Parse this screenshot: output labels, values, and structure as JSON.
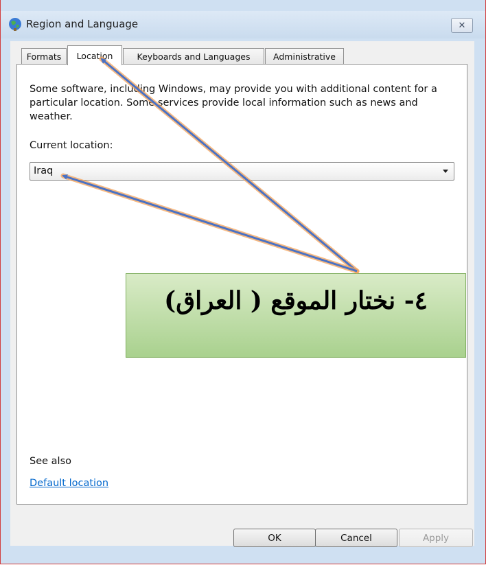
{
  "window": {
    "title": "Region and Language",
    "close_glyph": "✕",
    "icon": "globe-icon"
  },
  "tabs": [
    {
      "label": "Formats"
    },
    {
      "label": "Location"
    },
    {
      "label": "Keyboards and Languages"
    },
    {
      "label": "Administrative"
    }
  ],
  "active_tab": "Location",
  "location_panel": {
    "description": "Some software, including Windows, may provide you with additional content for a particular location. Some services provide local information such as news and weather.",
    "current_location_label": "Current location:",
    "current_location_value": "Iraq",
    "see_also_label": "See also",
    "default_location_link": "Default location"
  },
  "buttons": {
    "ok": "OK",
    "cancel": "Cancel",
    "apply": "Apply"
  },
  "annotation": {
    "callout_text": "٤- نختار الموقع ( العراق)",
    "arrow_color": "#4a72c4",
    "arrow_glow_color": "#f5a35a"
  },
  "colors": {
    "callout_fill": "#c6e0b4",
    "link": "#0066cc",
    "window_frame": "#cfe0f2"
  }
}
